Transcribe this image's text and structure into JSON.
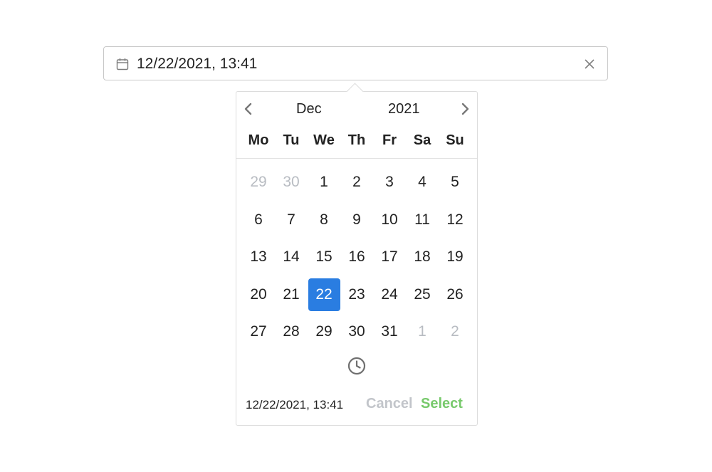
{
  "input": {
    "value": "12/22/2021, 13:41",
    "calendar_icon": "calendar-icon",
    "clear_icon": "close-icon"
  },
  "picker": {
    "month": "Dec",
    "year": "2021",
    "prev_icon": "chevron-left-icon",
    "next_icon": "chevron-right-icon",
    "weekdays": [
      "Mo",
      "Tu",
      "We",
      "Th",
      "Fr",
      "Sa",
      "Su"
    ],
    "days": [
      {
        "label": "29",
        "muted": true
      },
      {
        "label": "30",
        "muted": true
      },
      {
        "label": "1"
      },
      {
        "label": "2"
      },
      {
        "label": "3"
      },
      {
        "label": "4"
      },
      {
        "label": "5"
      },
      {
        "label": "6"
      },
      {
        "label": "7"
      },
      {
        "label": "8"
      },
      {
        "label": "9"
      },
      {
        "label": "10"
      },
      {
        "label": "11"
      },
      {
        "label": "12"
      },
      {
        "label": "13"
      },
      {
        "label": "14"
      },
      {
        "label": "15"
      },
      {
        "label": "16"
      },
      {
        "label": "17"
      },
      {
        "label": "18"
      },
      {
        "label": "19"
      },
      {
        "label": "20"
      },
      {
        "label": "21"
      },
      {
        "label": "22",
        "selected": true
      },
      {
        "label": "23"
      },
      {
        "label": "24"
      },
      {
        "label": "25"
      },
      {
        "label": "26"
      },
      {
        "label": "27"
      },
      {
        "label": "28"
      },
      {
        "label": "29"
      },
      {
        "label": "30"
      },
      {
        "label": "31"
      },
      {
        "label": "1",
        "muted": true
      },
      {
        "label": "2",
        "muted": true
      }
    ],
    "time_icon": "clock-icon",
    "footer_value": "12/22/2021, 13:41",
    "cancel_label": "Cancel",
    "select_label": "Select"
  },
  "colors": {
    "accent": "#2a7de1",
    "select": "#77c96b",
    "muted": "#b8bcc2"
  }
}
